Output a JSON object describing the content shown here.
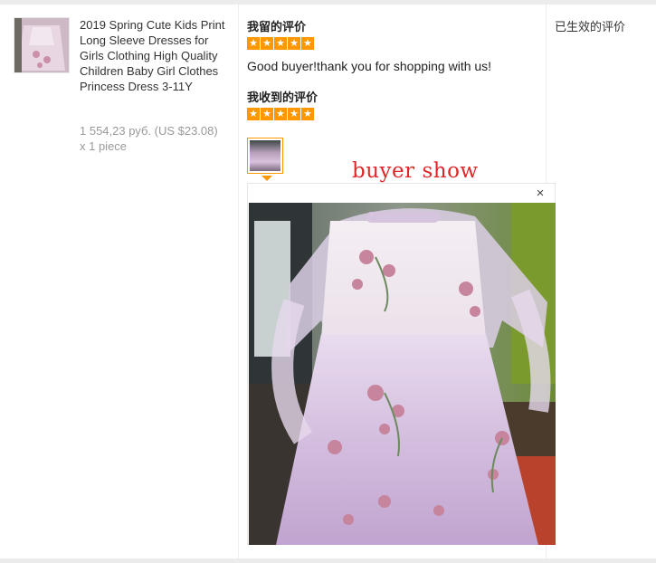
{
  "product": {
    "thumbnail_icon": "dress-photo",
    "title": "2019 Spring Cute Kids Print Long Sleeve Dresses for Girls Clothing High Quality Children Baby Girl Clothes Princess Dress 3-11Y",
    "price": "1 554,23 руб. (US $23.08)",
    "quantity": "x 1 piece"
  },
  "my_review": {
    "heading": "我留的评价",
    "rating": 5,
    "text": "Good buyer!thank you for shopping with us!"
  },
  "received_review": {
    "heading": "我收到的评价",
    "rating": 5,
    "photo_icon": "review-photo",
    "caption_overlay": "buyer show",
    "close_label": "×"
  },
  "status_column": {
    "label": "已生效的评价"
  },
  "colors": {
    "star": "#ff9700",
    "caption": "#e0262a",
    "divider": "#ececec"
  }
}
